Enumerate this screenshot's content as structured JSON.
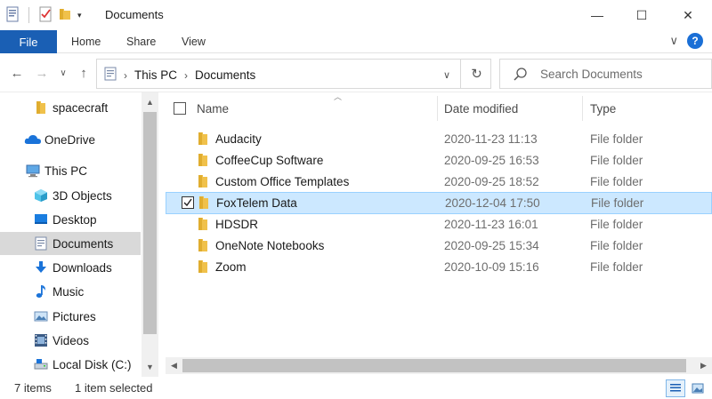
{
  "window": {
    "title": "Documents",
    "minimize_glyph": "—",
    "maximize_glyph": "☐",
    "close_glyph": "✕"
  },
  "ribbon": {
    "tabs": [
      "File",
      "Home",
      "Share",
      "View"
    ],
    "collapse_glyph": "∨",
    "help_glyph": "?"
  },
  "address": {
    "back_glyph": "←",
    "forward_glyph": "→",
    "recent_glyph": "∨",
    "up_glyph": "↑",
    "crumbs": [
      "This PC",
      "Documents"
    ],
    "crumb_sep": "›",
    "dropdown_glyph": "∨",
    "refresh_glyph": "↻"
  },
  "search": {
    "placeholder": "Search Documents"
  },
  "nav": {
    "items": [
      {
        "label": "spacecraft",
        "icon": "folder-icon"
      },
      {
        "label": "OneDrive",
        "icon": "onedrive-icon"
      },
      {
        "label": "This PC",
        "icon": "computer-icon"
      },
      {
        "label": "3D Objects",
        "icon": "3d-objects-icon"
      },
      {
        "label": "Desktop",
        "icon": "desktop-icon"
      },
      {
        "label": "Documents",
        "icon": "documents-icon",
        "selected": true
      },
      {
        "label": "Downloads",
        "icon": "downloads-icon"
      },
      {
        "label": "Music",
        "icon": "music-icon"
      },
      {
        "label": "Pictures",
        "icon": "pictures-icon"
      },
      {
        "label": "Videos",
        "icon": "videos-icon"
      },
      {
        "label": "Local Disk (C:)",
        "icon": "local-disk-icon"
      }
    ]
  },
  "files": {
    "columns": {
      "name": "Name",
      "date": "Date modified",
      "type": "Type"
    },
    "rows": [
      {
        "name": "Audacity",
        "date": "2020-11-23 11:13",
        "type": "File folder"
      },
      {
        "name": "CoffeeCup Software",
        "date": "2020-09-25 16:53",
        "type": "File folder"
      },
      {
        "name": "Custom Office Templates",
        "date": "2020-09-25 18:52",
        "type": "File folder"
      },
      {
        "name": "FoxTelem Data",
        "date": "2020-12-04 17:50",
        "type": "File folder",
        "selected": true
      },
      {
        "name": "HDSDR",
        "date": "2020-11-23 16:01",
        "type": "File folder"
      },
      {
        "name": "OneNote Notebooks",
        "date": "2020-09-25 15:34",
        "type": "File folder"
      },
      {
        "name": "Zoom",
        "date": "2020-10-09 15:16",
        "type": "File folder"
      }
    ]
  },
  "status": {
    "item_count": "7 items",
    "selection": "1 item selected"
  },
  "colors": {
    "accent": "#1a5fb4",
    "selection_bg": "#cce8ff",
    "selection_border": "#99d1ff",
    "folder": "#f0c14b",
    "nav_selected": "#d9d9d9"
  }
}
